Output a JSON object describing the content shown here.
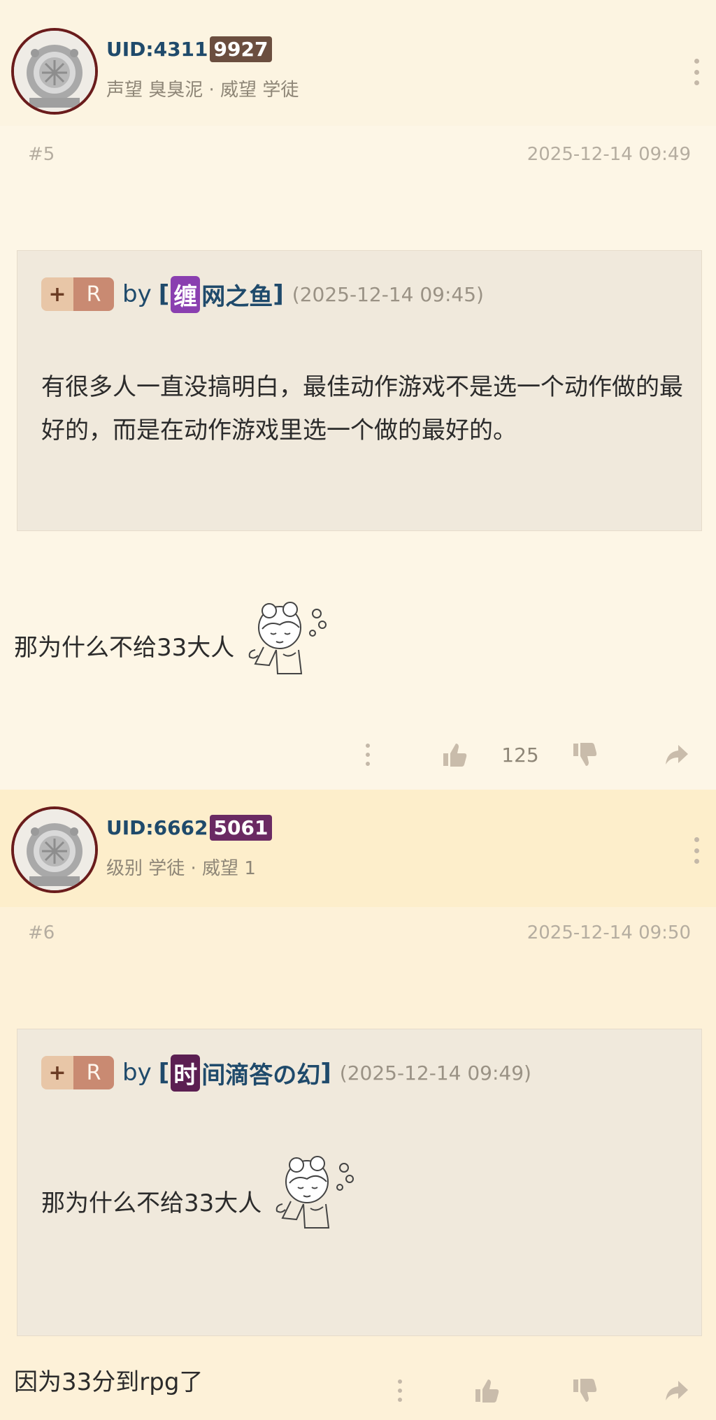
{
  "colors": {
    "uid_badge_post5": "#6b4e3f",
    "uid_badge_post6": "#6a2a63",
    "name_badge_post5": "#8a3fb0",
    "name_badge_post6": "#5b1f52",
    "action_icon": "#c9bcab"
  },
  "posts": [
    {
      "uid_prefix": "UID:4311",
      "uid_badge": "9927",
      "meta": "声望 臭臭泥 · 威望 学徒",
      "floor": "#5",
      "time": "2025-12-14 09:49",
      "quote": {
        "plus_label": "+",
        "r_label": "R",
        "by": "by",
        "bracket_open": "[",
        "name_first_char": "缠",
        "name_rest": "网之鱼",
        "bracket_close": "]",
        "time": "(2025-12-14 09:45)",
        "text": "有很多人一直没搞明白，最佳动作游戏不是选一个动作做的最好的，而是在动作游戏里选一个做的最好的。"
      },
      "body": "那为什么不给33大人",
      "sticker_icon": "sticker-girl-icon",
      "votes": "125"
    },
    {
      "uid_prefix": "UID:6662",
      "uid_badge": "5061",
      "meta": "级别 学徒 · 威望 1",
      "floor": "#6",
      "time": "2025-12-14 09:50",
      "quote": {
        "plus_label": "+",
        "r_label": "R",
        "by": "by",
        "bracket_open": "[",
        "name_first_char": "时",
        "name_rest": "间滴答の幻",
        "bracket_close": "]",
        "time": "(2025-12-14 09:49)",
        "text": "那为什么不给33大人"
      },
      "body": "因为33分到rpg了",
      "sticker_icon": "sticker-girl-icon",
      "votes": ""
    }
  ],
  "icons": {
    "avatar": "diving-helmet-icon",
    "more": "more-vertical-icon",
    "like": "thumbs-up-icon",
    "dislike": "thumbs-down-icon",
    "share": "share-arrow-icon"
  }
}
